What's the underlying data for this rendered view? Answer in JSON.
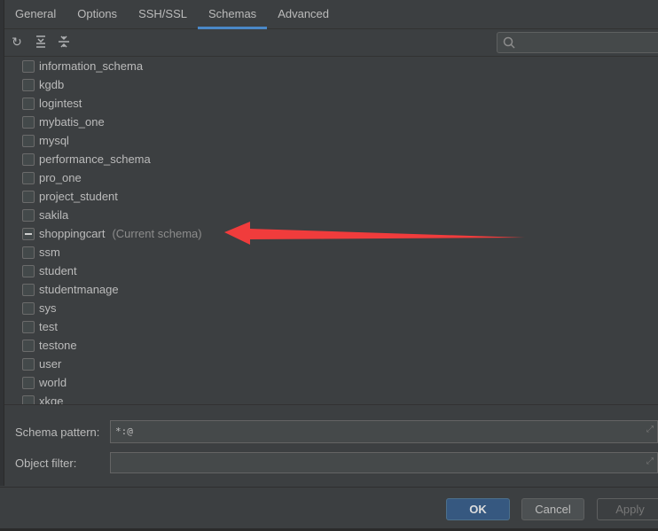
{
  "tabs": [
    {
      "label": "General"
    },
    {
      "label": "Options"
    },
    {
      "label": "SSH/SSL"
    },
    {
      "label": "Schemas",
      "active": true
    },
    {
      "label": "Advanced"
    }
  ],
  "toolbar": {
    "icons": [
      "refresh-icon",
      "expand-all-icon",
      "collapse-all-icon"
    ]
  },
  "search": {
    "value": "",
    "placeholder": ""
  },
  "schemas": [
    {
      "name": "information_schema",
      "checked": false
    },
    {
      "name": "kgdb",
      "checked": false
    },
    {
      "name": "logintest",
      "checked": false
    },
    {
      "name": "mybatis_one",
      "checked": false
    },
    {
      "name": "mysql",
      "checked": false
    },
    {
      "name": "performance_schema",
      "checked": false
    },
    {
      "name": "pro_one",
      "checked": false
    },
    {
      "name": "project_student",
      "checked": false
    },
    {
      "name": "sakila",
      "checked": false
    },
    {
      "name": "shoppingcart",
      "checked": "partial",
      "note": "(Current schema)"
    },
    {
      "name": "ssm",
      "checked": false
    },
    {
      "name": "student",
      "checked": false
    },
    {
      "name": "studentmanage",
      "checked": false
    },
    {
      "name": "sys",
      "checked": false
    },
    {
      "name": "test",
      "checked": false
    },
    {
      "name": "testone",
      "checked": false
    },
    {
      "name": "user",
      "checked": false
    },
    {
      "name": "world",
      "checked": false
    },
    {
      "name": "xkge",
      "checked": false
    }
  ],
  "fields": {
    "schema_pattern_label": "Schema pattern:",
    "schema_pattern_value": "*:@",
    "object_filter_label": "Object filter:",
    "object_filter_value": ""
  },
  "buttons": {
    "ok": "OK",
    "cancel": "Cancel",
    "apply": "Apply"
  },
  "colors": {
    "accent": "#4a88c7",
    "annotation_arrow": "#f03c3c",
    "ok_button": "#365880"
  }
}
